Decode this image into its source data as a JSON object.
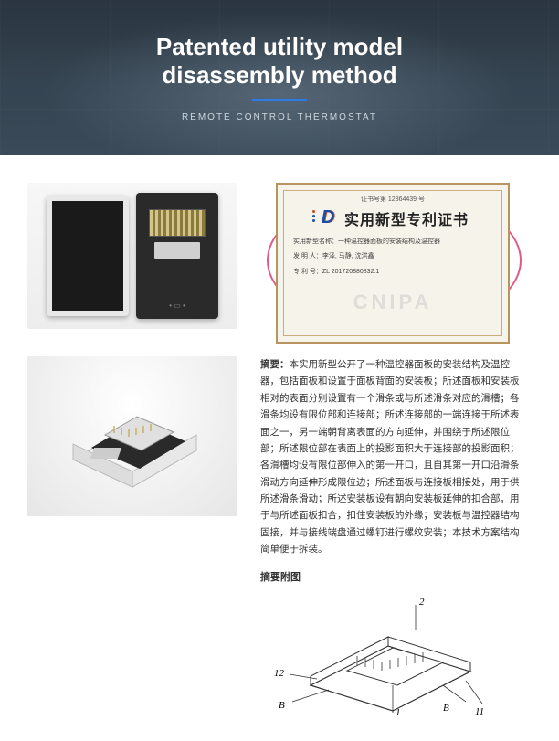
{
  "hero": {
    "title_line1": "Patented utility model",
    "title_line2": "disassembly method",
    "subtitle": "REMOTE CONTROL THERMOSTAT"
  },
  "certificate": {
    "top_number": "证书号第 12864439 号",
    "title": "实用新型专利证书",
    "line1": "实用新型名称：一种温控器面板的安装结构及温控器",
    "line2": "发 明 人：李泽, 马静, 沈洪鑫",
    "line3": "专 利 号：ZL 201720880832.1",
    "watermark": "CNIPA"
  },
  "abstract": {
    "heading": "摘要：",
    "body": "本实用新型公开了一种温控器面板的安装结构及温控器，包括面板和设置于面板背面的安装板；所述面板和安装板相对的表面分别设置有一个滑条或与所述滑条对应的滑槽；各滑条均设有限位部和连接部；所述连接部的一端连接于所述表面之一，另一端朝背离表面的方向延伸，并围绕于所述限位部；所述限位部在表面上的投影面积大于连接部的投影面积；各滑槽均设有限位部伸入的第一开口，且自其第一开口沿滑条滑动方向延伸形成限位边；所述面板与连接板相接处，用于供所述滑条滑动；所述安装板设有朝向安装板延伸的扣合部，用于与所述面板扣合，扣住安装板的外缘；安装板与温控器结构固接，并与接线端盘通过螺钉进行螺纹安装；本技术方案结构简单便于拆装。",
    "figure_heading": "摘要附图"
  },
  "diagram_labels": {
    "top_right": "2",
    "left_num": "12",
    "left_letter": "B",
    "bottom_right_num": "11",
    "right_letter": "B",
    "center_num": "1"
  }
}
